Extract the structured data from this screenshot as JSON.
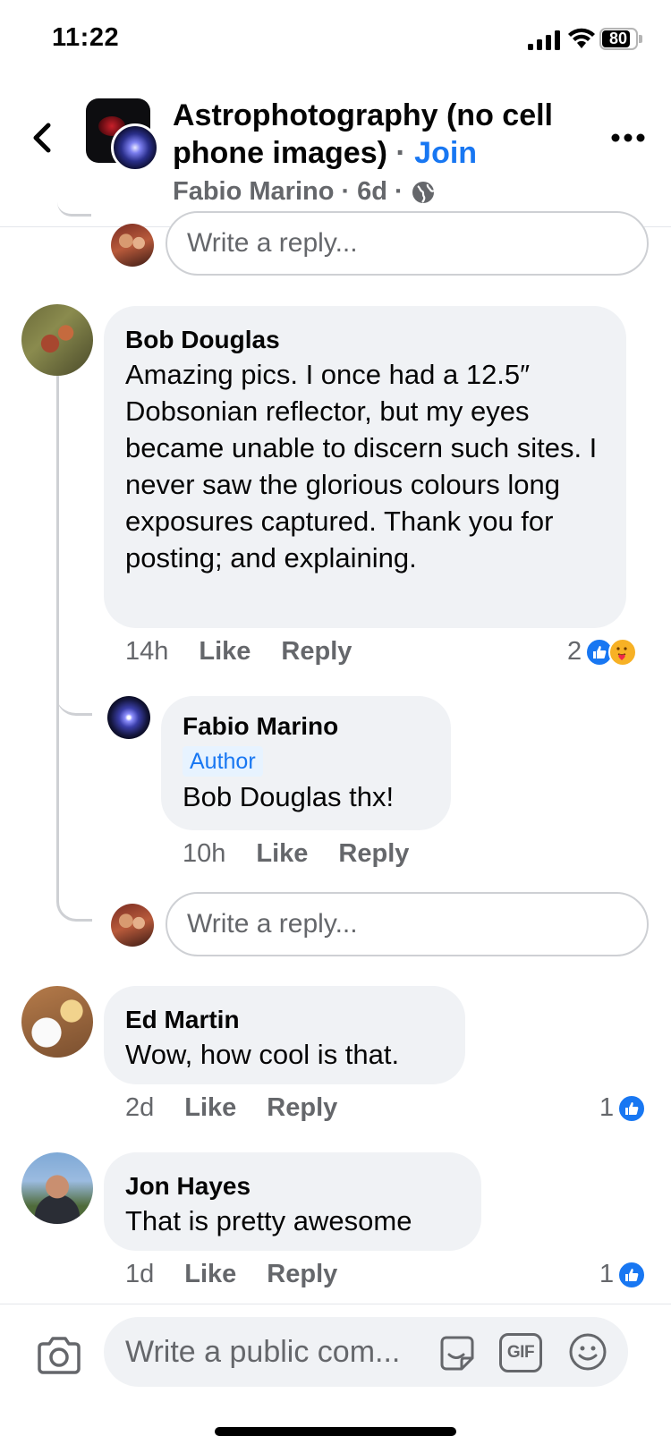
{
  "status_bar": {
    "time": "11:22",
    "battery": "80",
    "battery_level": 0.8
  },
  "header": {
    "title": "Astrophotography (no cell phone images)",
    "separator": "·",
    "join_label": "Join",
    "author": "Fabio Marino",
    "dot": "·",
    "age": "6d",
    "dot2": "·",
    "icons": {
      "back": "chevron-left-icon",
      "more": "more-horizontal-icon",
      "privacy": "globe-icon"
    }
  },
  "reply_placeholder": "Write a reply...",
  "comments": [
    {
      "name": "Bob Douglas",
      "text": "Amazing pics. I once had a 12.5″ Dobsonian reflector, but my eyes became unable to discern such sites. I never saw the glorious colours long exposures captured. Thank you for posting; and explaining.",
      "time": "14h",
      "like_label": "Like",
      "reply_label": "Reply",
      "reaction_count": "2",
      "reactions": [
        "like-icon",
        "care-icon"
      ],
      "replies": [
        {
          "name": "Fabio Marino",
          "badge": "Author",
          "text": "Bob Douglas thx!",
          "time": "10h",
          "like_label": "Like",
          "reply_label": "Reply"
        }
      ]
    },
    {
      "name": "Ed Martin",
      "text": "Wow, how cool is that.",
      "time": "2d",
      "like_label": "Like",
      "reply_label": "Reply",
      "reaction_count": "1",
      "reactions": [
        "like-icon"
      ]
    },
    {
      "name": "Jon Hayes",
      "text": "That is pretty awesome",
      "time": "1d",
      "like_label": "Like",
      "reply_label": "Reply",
      "reaction_count": "1",
      "reactions": [
        "like-icon"
      ]
    }
  ],
  "composer": {
    "placeholder": "Write a public com...",
    "gif_label": "GIF",
    "icons": {
      "camera": "camera-icon",
      "sticker": "sticker-icon",
      "gif": "gif-icon",
      "emoji": "emoji-icon"
    }
  },
  "colors": {
    "accent": "#1877f2",
    "bubble": "#f0f2f5",
    "secondary_text": "#65676b",
    "care": "#f7b125"
  }
}
